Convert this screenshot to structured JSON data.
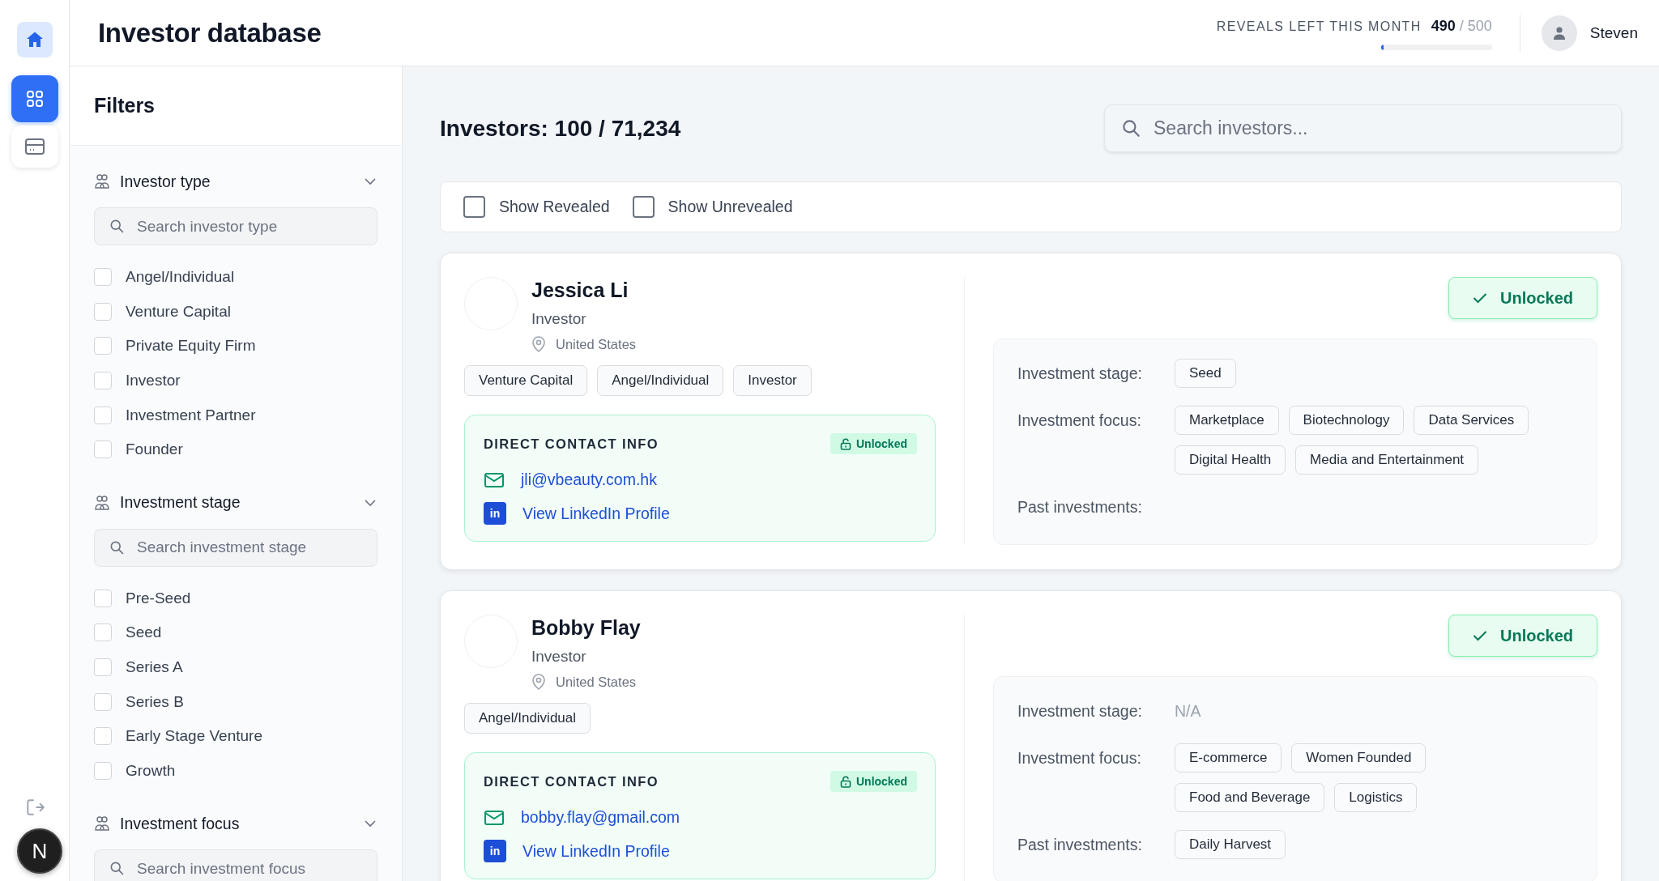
{
  "nav_rail": {
    "items": [
      {
        "selected": false,
        "highlighted": true
      },
      {
        "selected": true,
        "highlighted": false
      },
      {
        "selected": false,
        "highlighted": false
      }
    ],
    "dev_indicator": "N"
  },
  "header": {
    "title": "Investor database",
    "reveals": {
      "label": "REVEALS LEFT THIS MONTH",
      "count": "490",
      "total": "/ 500",
      "level": 0.02
    },
    "user": {
      "name": "Steven"
    }
  },
  "filters": {
    "title": "Filters",
    "sections": [
      {
        "title": "Investor type",
        "expanded": true,
        "placeholder": "Search investor type",
        "options": [
          {
            "label": "Angel/Individual",
            "checked": false
          },
          {
            "label": "Venture Capital",
            "checked": false
          },
          {
            "label": "Private Equity Firm",
            "checked": false
          },
          {
            "label": "Investor",
            "checked": false
          },
          {
            "label": "Investment Partner",
            "checked": false
          },
          {
            "label": "Founder",
            "checked": false
          }
        ]
      },
      {
        "title": "Investment stage",
        "expanded": true,
        "placeholder": "Search investment stage",
        "options": [
          {
            "label": "Pre-Seed",
            "checked": false
          },
          {
            "label": "Seed",
            "checked": false
          },
          {
            "label": "Series A",
            "checked": false
          },
          {
            "label": "Series B",
            "checked": false
          },
          {
            "label": "Early Stage Venture",
            "checked": false
          },
          {
            "label": "Growth",
            "checked": false
          }
        ]
      },
      {
        "title": "Investment focus",
        "expanded": true,
        "placeholder": "Search investment focus"
      }
    ]
  },
  "main": {
    "count_title": "Investors: 100 / 71,234",
    "search": {
      "placeholder": "Search investors..."
    },
    "toggles": [
      {
        "label": "Show Revealed",
        "checked": false
      },
      {
        "label": "Show Unrevealed",
        "checked": false
      }
    ],
    "investors": [
      {
        "name": "Jessica Li",
        "title": "Investor",
        "location": "United States",
        "tags": [
          "Venture Capital",
          "Angel/Individual",
          "Investor"
        ],
        "unlocked": true,
        "status": "Unlocked",
        "contact": {
          "heading": "DIRECT CONTACT INFO",
          "badge": "Unlocked",
          "email": "jli@vbeauty.com.hk",
          "linkedin_mark": "in",
          "linkedin": "View LinkedIn Profile"
        },
        "details": [
          {
            "label": "Investment stage:",
            "values": [
              "Seed"
            ]
          },
          {
            "label": "Investment focus:",
            "values": [
              "Marketplace",
              "Biotechnology",
              "Data Services",
              "Digital Health",
              "Media and Entertainment"
            ]
          },
          {
            "label": "Past investments:"
          }
        ]
      },
      {
        "name": "Bobby Flay",
        "title": "Investor",
        "location": "United States",
        "tags": [
          "Angel/Individual"
        ],
        "unlocked": true,
        "status": "Unlocked",
        "contact": {
          "heading": "DIRECT CONTACT INFO",
          "badge": "Unlocked",
          "email": "bobby.flay@gmail.com",
          "linkedin_mark": "in",
          "linkedin": "View LinkedIn Profile"
        },
        "details": [
          {
            "label": "Investment stage:",
            "text": "N/A"
          },
          {
            "label": "Investment focus:",
            "values": [
              "E-commerce",
              "Women Founded",
              "Food and Beverage",
              "Logistics"
            ]
          },
          {
            "label": "Past investments:",
            "values": [
              "Daily Harvest"
            ]
          }
        ]
      }
    ]
  }
}
